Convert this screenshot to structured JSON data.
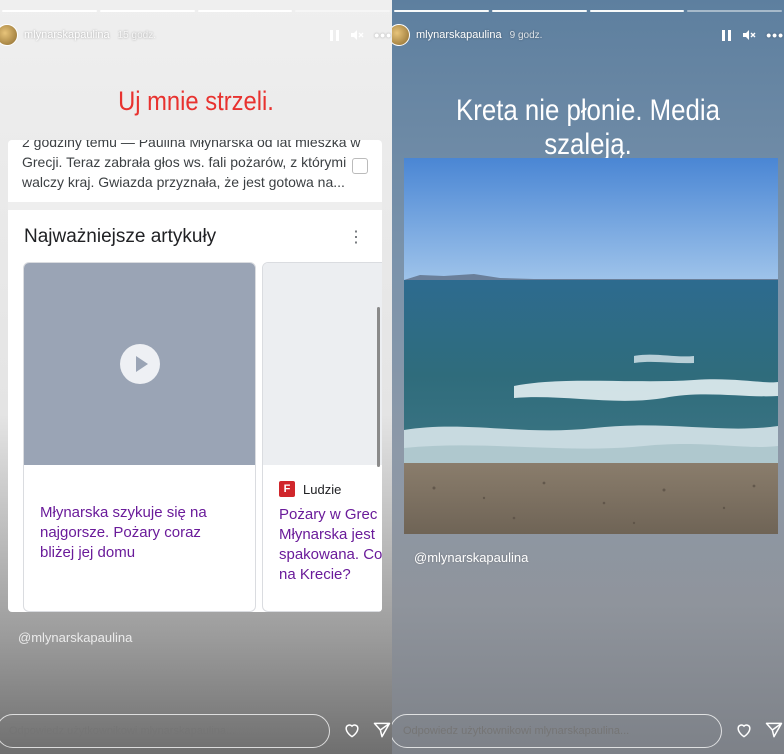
{
  "stories": [
    {
      "username": "mlynarskapaulina",
      "time": "15 godz.",
      "caption": "Uj mnie strzeli.",
      "colors": {
        "caption": "#e8322f",
        "link": "#6a1b9a"
      },
      "snippet": {
        "line0": "2 godziny temu — Paulina Młynarska od lat mieszka w",
        "line1": "Grecji. Teraz zabrała głos ws. fali pożarów, z którymi",
        "line2": "walczy kraj. Gwiazda przyznała, że jest gotowa na..."
      },
      "top_articles": {
        "title": "Najważniejsze artykuły",
        "cards": [
          {
            "headline": "Młynarska szykuje się na\nnajgorsze. Pożary coraz\nbliżej jej domu"
          },
          {
            "source_logo": "F",
            "source": "Ludzie",
            "headline": "Pożary w Grec\nMłynarska jest\nspakowana. Co\nna Krecie?"
          }
        ]
      },
      "handle": "@mlynarskapaulina",
      "reply_placeholder": "Odpowiedz użytkownikowi mlynarskapaulina..."
    },
    {
      "username": "mlynarskapaulina",
      "time": "9 godz.",
      "caption": "Kreta nie płonie. Media szaleją.",
      "handle": "@mlynarskapaulina",
      "reply_placeholder": "Odpowiedz użytkownikowi mlynarskapaulina..."
    }
  ],
  "icons": [
    "pause-icon",
    "mute-icon",
    "more-icon",
    "play-icon",
    "heart-icon",
    "send-icon",
    "menu-icon"
  ]
}
